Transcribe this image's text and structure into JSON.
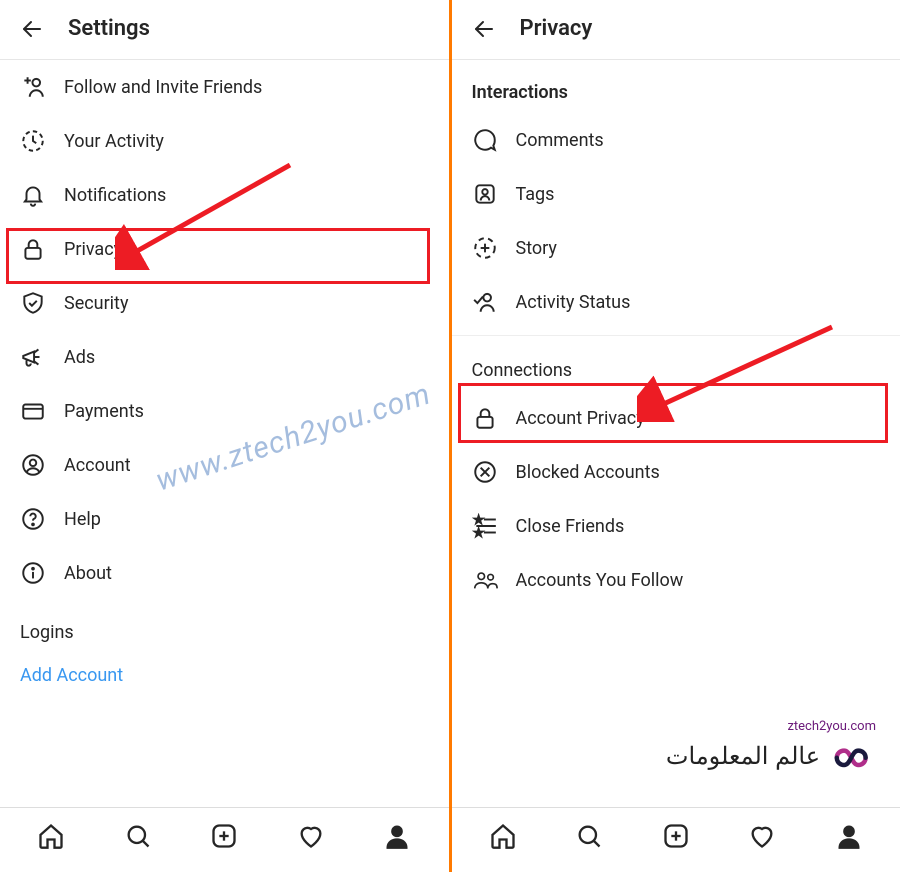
{
  "left": {
    "header_title": "Settings",
    "items": [
      {
        "label": "Follow and Invite Friends",
        "icon": "add-person-icon"
      },
      {
        "label": "Your Activity",
        "icon": "clock-icon"
      },
      {
        "label": "Notifications",
        "icon": "bell-icon"
      },
      {
        "label": "Privacy",
        "icon": "lock-icon"
      },
      {
        "label": "Security",
        "icon": "shield-check-icon"
      },
      {
        "label": "Ads",
        "icon": "megaphone-icon"
      },
      {
        "label": "Payments",
        "icon": "card-icon"
      },
      {
        "label": "Account",
        "icon": "person-circle-icon"
      },
      {
        "label": "Help",
        "icon": "help-circle-icon"
      },
      {
        "label": "About",
        "icon": "info-circle-icon"
      }
    ],
    "section_logins": "Logins",
    "add_account": "Add Account"
  },
  "right": {
    "header_title": "Privacy",
    "section_interactions": "Interactions",
    "interaction_items": [
      {
        "label": "Comments",
        "icon": "comment-icon"
      },
      {
        "label": "Tags",
        "icon": "tag-person-icon"
      },
      {
        "label": "Story",
        "icon": "story-plus-icon"
      },
      {
        "label": "Activity Status",
        "icon": "person-check-icon"
      }
    ],
    "section_connections": "Connections",
    "connection_items": [
      {
        "label": "Account Privacy",
        "icon": "lock-icon"
      },
      {
        "label": "Blocked Accounts",
        "icon": "x-circle-icon"
      },
      {
        "label": "Close Friends",
        "icon": "star-list-icon"
      },
      {
        "label": "Accounts You Follow",
        "icon": "people-icon"
      }
    ]
  },
  "watermark": "www.ztech2you.com",
  "logo": {
    "url": "ztech2you.com",
    "arabic": "عالم المعلومات"
  },
  "colors": {
    "highlight": "#ed1c24",
    "divider": "#ff7a00",
    "link": "#3897f0",
    "accent": "#6b1a7a"
  }
}
